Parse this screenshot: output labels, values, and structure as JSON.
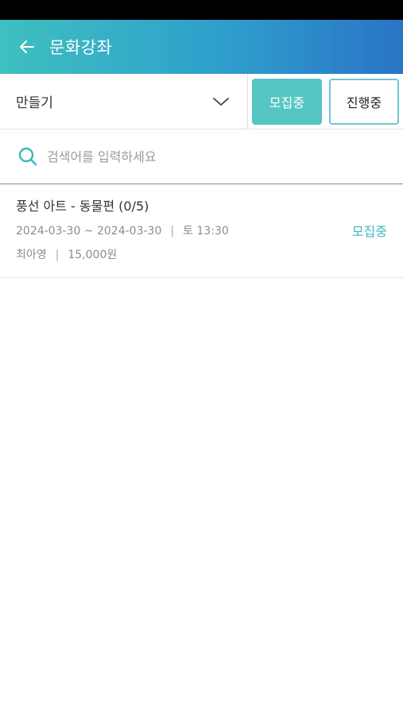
{
  "header": {
    "title": "문화강좌"
  },
  "filter": {
    "category": "만들기",
    "status_buttons": [
      {
        "label": "모집중",
        "active": true
      },
      {
        "label": "진행중",
        "active": false
      }
    ]
  },
  "search": {
    "placeholder": "검색어를 입력하세요",
    "value": ""
  },
  "courses": [
    {
      "title": "풍선 아트 - 동물편 (0/5)",
      "date_range": "2024-03-30 ~ 2024-03-30",
      "separator": "|",
      "schedule": "토 13:30",
      "instructor": "최아영",
      "price": "15,000원",
      "status": "모집중"
    }
  ],
  "colors": {
    "accent": "#56c6c4",
    "header_gradient_start": "#3ec0c0",
    "header_gradient_end": "#2a74c6",
    "status_text": "#3bb8be"
  }
}
